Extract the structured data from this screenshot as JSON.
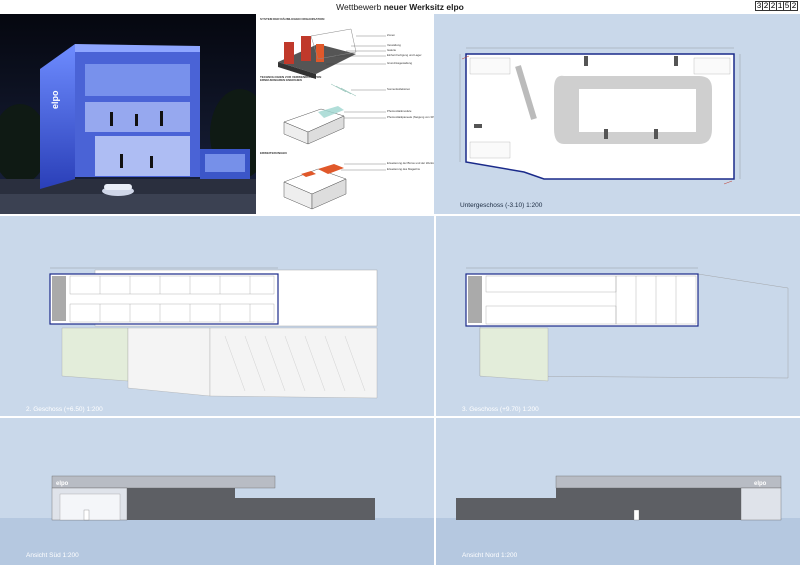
{
  "header": {
    "title_prefix": "Wettbewerb",
    "title_main": "neuer Werksitz elpo",
    "code_digits": [
      "3",
      "2",
      "2",
      "1",
      "5",
      "2"
    ]
  },
  "diagrams": {
    "heading1": "SYSTEM DER RÄUMLICHEN ORGANISATION",
    "labels1": [
      "Zonen",
      "Verwaltung",
      "Galerie",
      "Einheit Fertigung und Lager",
      "Grundrissgestaltung"
    ],
    "heading2": "TECHNOLOGIEN ZUR VERWENDUNG VON ERNEUERBAREN ENERGIEN",
    "labels2": [
      "Sonnenkollektoren",
      "Photovoltaikmodule",
      "Photovoltaikpaneele (Neigung von 30°)"
    ],
    "heading3": "ERWEITERUNGEN",
    "labels3": [
      "Erweiterung der Büros und der Werkstattfläche",
      "Erweiterung des Magazins"
    ]
  },
  "captions": {
    "basement": "Untergeschoss (-3.10) 1:200",
    "floor2": "2. Geschoss (+6.50) 1:200",
    "floor3": "3. Geschoss (+9.70) 1:200",
    "view_south": "Ansicht Süd 1:200",
    "view_north": "Ansicht Nord 1:200"
  },
  "logo": "elpo",
  "colors": {
    "panel": "#c9d8ea",
    "plan_outline": "#1a2a8a",
    "accent_red": "#c0392b",
    "accent_orange": "#e0582a"
  }
}
